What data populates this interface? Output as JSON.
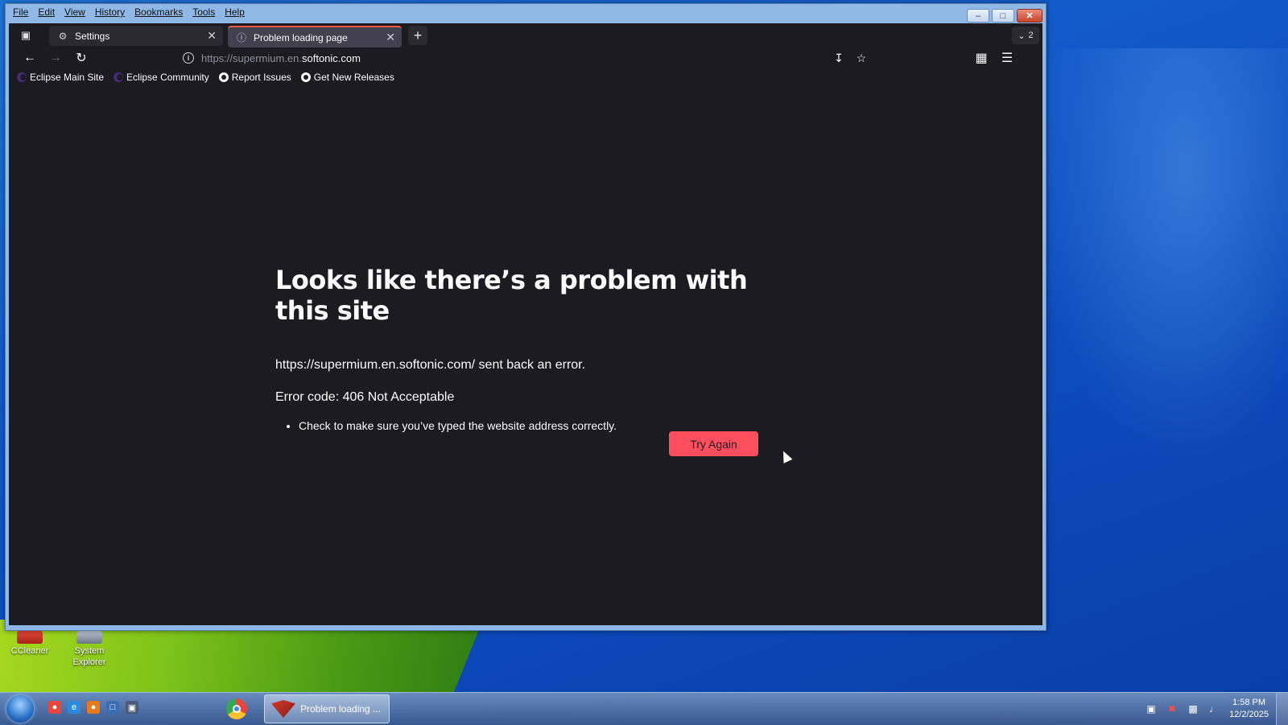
{
  "desktop": {
    "icons": [
      {
        "label": "CCleaner"
      },
      {
        "label": "System Explorer"
      }
    ]
  },
  "window": {
    "menu": [
      "File",
      "Edit",
      "View",
      "History",
      "Bookmarks",
      "Tools",
      "Help"
    ],
    "tabs": [
      {
        "title": "Settings",
        "icon": "gear-icon",
        "active": false
      },
      {
        "title": "Problem loading page",
        "icon": "info-icon",
        "active": true
      }
    ],
    "tab_count": "2",
    "address": {
      "prefix": "https://supermium.en.",
      "domain": "softonic.com"
    },
    "bookmarks": [
      {
        "label": "Eclipse Main Site",
        "icon": "eclipse-icon"
      },
      {
        "label": "Eclipse Community",
        "icon": "eclipse-icon"
      },
      {
        "label": "Report Issues",
        "icon": "github-icon"
      },
      {
        "label": "Get New Releases",
        "icon": "github-icon"
      }
    ]
  },
  "error_page": {
    "title": "Looks like there’s a problem with this site",
    "message": "https://supermium.en.softonic.com/ sent back an error.",
    "code": "Error code: 406 Not Acceptable",
    "tips": [
      "Check to make sure you’ve typed the website address correctly."
    ],
    "button": "Try Again"
  },
  "taskbar": {
    "active_task": "Problem loading ...",
    "time": "1:58 PM",
    "date": "12/2/2025"
  },
  "colors": {
    "accent": "#ff4f5e",
    "page_bg": "#1c1b22",
    "text": "#fbfbfe"
  }
}
